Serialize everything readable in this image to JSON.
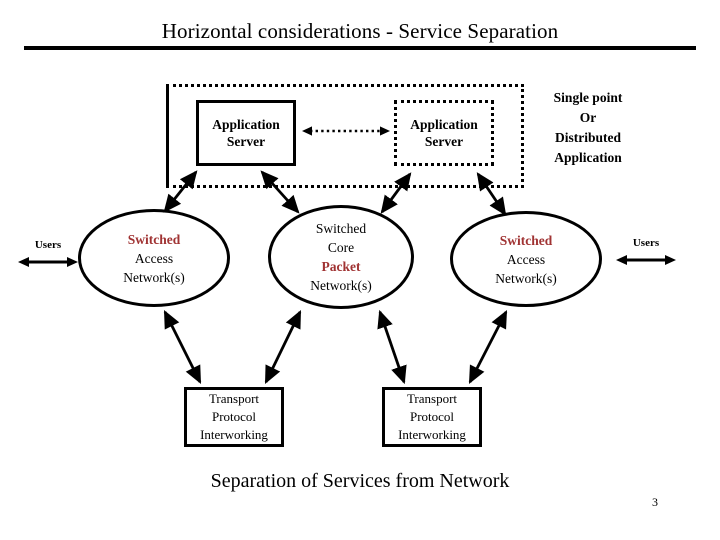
{
  "slide": {
    "title": "Horizontal considerations - Service Separation",
    "bottom_caption": "Separation of Services from Network",
    "page_number": "3"
  },
  "colors": {
    "accent_red": "#A03333",
    "text_black": "#000000",
    "background": "#FFFFFF"
  },
  "group_region": {
    "name": "service-separation-boundary",
    "border_style": "dotted"
  },
  "app_servers": [
    {
      "id": "appserver-left",
      "line1": "Application",
      "line2": "Server",
      "border_style": "solid"
    },
    {
      "id": "appserver-right",
      "line1": "Application",
      "line2": "Server",
      "border_style": "dotted"
    }
  ],
  "link_arrow": {
    "style": "dotted",
    "heads": "both"
  },
  "side_caption": {
    "line1": "Single point",
    "line2": "Or",
    "line3": "Distributed",
    "line4": "Application"
  },
  "ellipses": [
    {
      "id": "ellipse-left",
      "lines": [
        {
          "text": "Switched",
          "color": "#A03333",
          "bold": true
        },
        {
          "text": "Access",
          "color": "#000000",
          "bold": false
        },
        {
          "text": "Network(s)",
          "color": "#000000",
          "bold": false
        }
      ]
    },
    {
      "id": "ellipse-center",
      "lines": [
        {
          "text": "Switched",
          "color": "#000000",
          "bold": false
        },
        {
          "text": "Core",
          "color": "#000000",
          "bold": false
        },
        {
          "text": "Packet",
          "color": "#A03333",
          "bold": true
        },
        {
          "text": "Network(s)",
          "color": "#000000",
          "bold": false
        }
      ]
    },
    {
      "id": "ellipse-right",
      "lines": [
        {
          "text": "Switched",
          "color": "#A03333",
          "bold": true
        },
        {
          "text": "Access",
          "color": "#000000",
          "bold": false
        },
        {
          "text": "Network(s)",
          "color": "#000000",
          "bold": false
        }
      ]
    }
  ],
  "users": [
    {
      "id": "users-left",
      "label": "Users"
    },
    {
      "id": "users-right",
      "label": "Users"
    }
  ],
  "transport_boxes": [
    {
      "id": "transport-left",
      "line1": "Transport",
      "line2": "Protocol",
      "line3": "Interworking"
    },
    {
      "id": "transport-right",
      "line1": "Transport",
      "line2": "Protocol",
      "line3": "Interworking"
    }
  ]
}
